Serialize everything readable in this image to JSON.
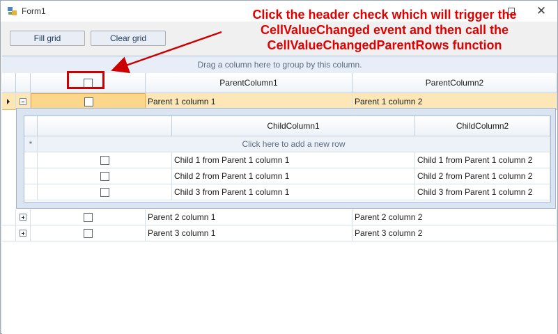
{
  "window": {
    "title": "Form1",
    "maximize_label": "",
    "close_label": "✕"
  },
  "toolbar": {
    "fill_label": "Fill grid",
    "clear_label": "Clear grid"
  },
  "grid": {
    "group_panel_text": "Drag a column here to group by this column.",
    "columns": [
      "ParentColumn1",
      "ParentColumn2"
    ],
    "rows": [
      {
        "col1": "Parent 1 column 1",
        "col2": "Parent 1 column 2",
        "expanded": true
      },
      {
        "col1": "Parent 2 column 1",
        "col2": "Parent 2 column 2",
        "expanded": false
      },
      {
        "col1": "Parent 3 column 1",
        "col2": "Parent 3 column 2",
        "expanded": false
      }
    ],
    "child": {
      "columns": [
        "ChildColumn1",
        "ChildColumn2"
      ],
      "new_row_marker": "*",
      "new_row_text": "Click here to add a new row",
      "rows": [
        {
          "col1": "Child 1 from Parent 1 column 1",
          "col2": "Child 1 from Parent 1 column 2"
        },
        {
          "col1": "Child 2 from Parent 1 column 1",
          "col2": "Child 2 from Parent 1 column 2"
        },
        {
          "col1": "Child 3 from Parent 1 column 1",
          "col2": "Child 3 from Parent 1 column 2"
        }
      ]
    }
  },
  "annotation": {
    "lines": [
      "Click the header check which will trigger the",
      "CellValueChanged event and then call the",
      "CellValueChangedParentRows function"
    ],
    "color": "#e00000"
  }
}
